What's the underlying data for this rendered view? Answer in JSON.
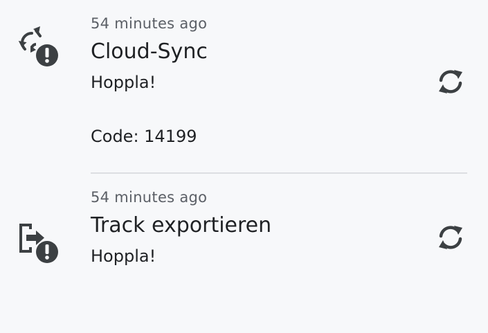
{
  "notifications": [
    {
      "icon": "cloud-sync-error-icon",
      "timestamp": "54 minutes ago",
      "title": "Cloud-Sync",
      "message": "Hoppla!",
      "code": "Code: 14199",
      "action_icon": "retry-sync-icon"
    },
    {
      "icon": "export-error-icon",
      "timestamp": "54 minutes ago",
      "title": "Track exportieren",
      "message": "Hoppla!",
      "action_icon": "retry-sync-icon"
    }
  ],
  "colors": {
    "background": "#f7f8fa",
    "icon": "#3c4043",
    "text": "#1f2124",
    "secondary_text": "#5b5f66",
    "divider": "#dcdee2"
  }
}
